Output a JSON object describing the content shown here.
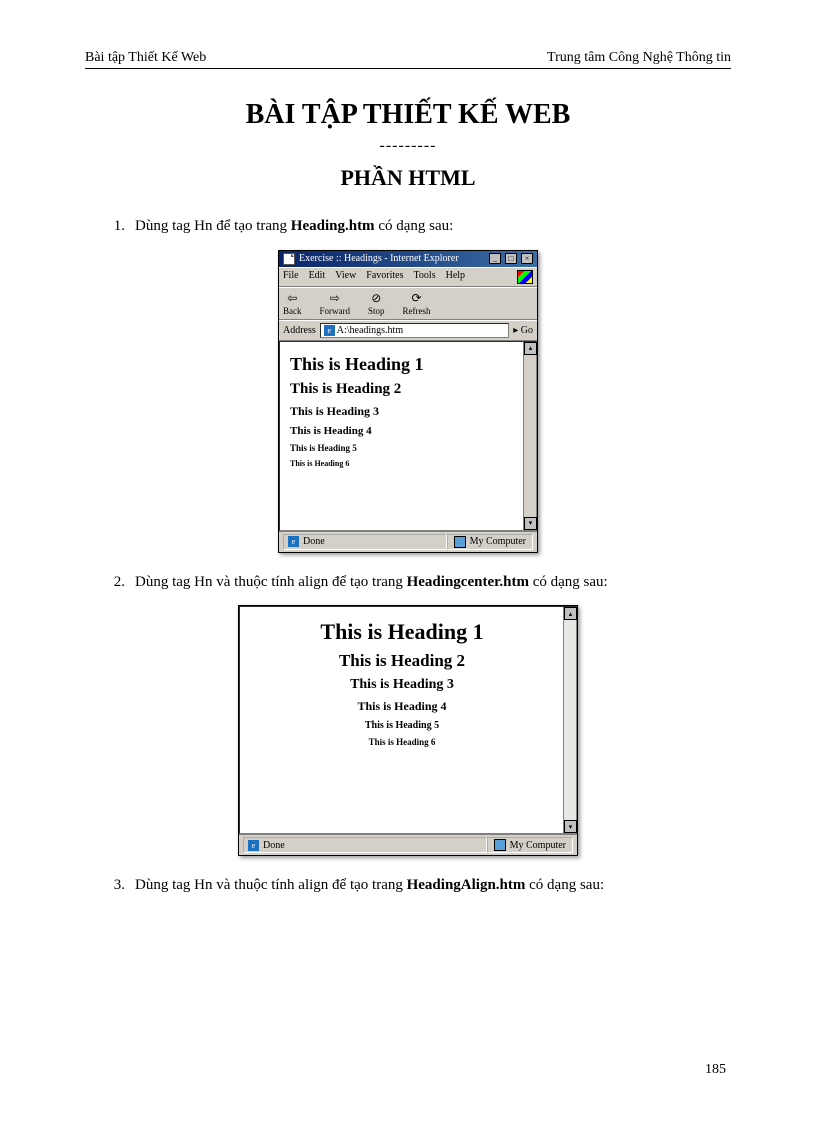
{
  "header": {
    "left": "Bài tập Thiết  Kế Web",
    "right": "Trung  tâm Công Nghệ Thông  tin"
  },
  "main_title": "BÀI TẬP THIẾT KẾ WEB",
  "divider": "---------",
  "subtitle": "PHẦN  HTML",
  "item1": {
    "num": "1.",
    "pre": "Dùng tag Hn để tạo trang ",
    "bold": "Heading.htm",
    "post": " có dạng sau:"
  },
  "ie1": {
    "title": "Exercise :: Headings - Internet Explorer",
    "menu": [
      "File",
      "Edit",
      "View",
      "Favorites",
      "Tools",
      "Help"
    ],
    "toolbar": {
      "back": "Back",
      "forward": "Forward",
      "stop": "Stop",
      "refresh": "Refresh"
    },
    "address_label": "Address",
    "address_value": "A:\\headings.htm",
    "go": "Go",
    "headings": {
      "h1": "This is Heading 1",
      "h2": "This is Heading 2",
      "h3": "This is Heading 3",
      "h4": "This is Heading 4",
      "h5": "This is Heading 5",
      "h6": "This is Heading 6"
    },
    "status_done": "Done",
    "status_zone": "My Computer"
  },
  "item2": {
    "num": "2.",
    "pre": "Dùng tag Hn và thuộc tính align để tạo trang ",
    "bold": "Headingcenter.htm",
    "post": " có dạng sau:"
  },
  "ie2": {
    "headings": {
      "h1": "This is Heading 1",
      "h2": "This is Heading 2",
      "h3": "This is Heading 3",
      "h4": "This is Heading 4",
      "h5": "This is Heading 5",
      "h6": "This is Heading 6"
    },
    "status_done": "Done",
    "status_zone": "My Computer"
  },
  "item3": {
    "num": "3.",
    "pre": "Dùng tag Hn và thuộc tính align để tạo trang ",
    "bold": "HeadingAlign.htm",
    "post": " có dạng sau:"
  },
  "page_number": "185"
}
